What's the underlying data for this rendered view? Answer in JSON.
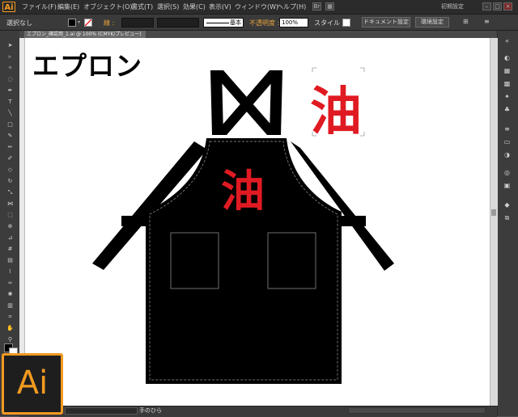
{
  "app": {
    "logo_small": "Ai",
    "logo_big": "Ai",
    "brand_color": "#f29a20"
  },
  "menu": {
    "items": [
      "ファイル(F)",
      "編集(E)",
      "オブジェクト(O)",
      "書式(T)",
      "選択(S)",
      "効果(C)",
      "表示(V)",
      "ウィンドウ(W)",
      "ヘルプ(H)"
    ],
    "workspace": "初期設定"
  },
  "control_bar": {
    "selection": "選択なし",
    "stroke_label": "線 :",
    "stroke_style": "基本",
    "opacity_label": "不透明度 :",
    "opacity_value": "100%",
    "style_label": "スタイル :",
    "doc_setup": "ドキュメント設定",
    "prefs": "環境設定"
  },
  "document": {
    "tab": "エプロン_確認用_1.ai @ 100% (CMYK/プレビュー)"
  },
  "artwork": {
    "title": "エプロン",
    "kanji": "油",
    "kanji_color": "#e01a22"
  },
  "status": {
    "tool": "手のひら"
  }
}
